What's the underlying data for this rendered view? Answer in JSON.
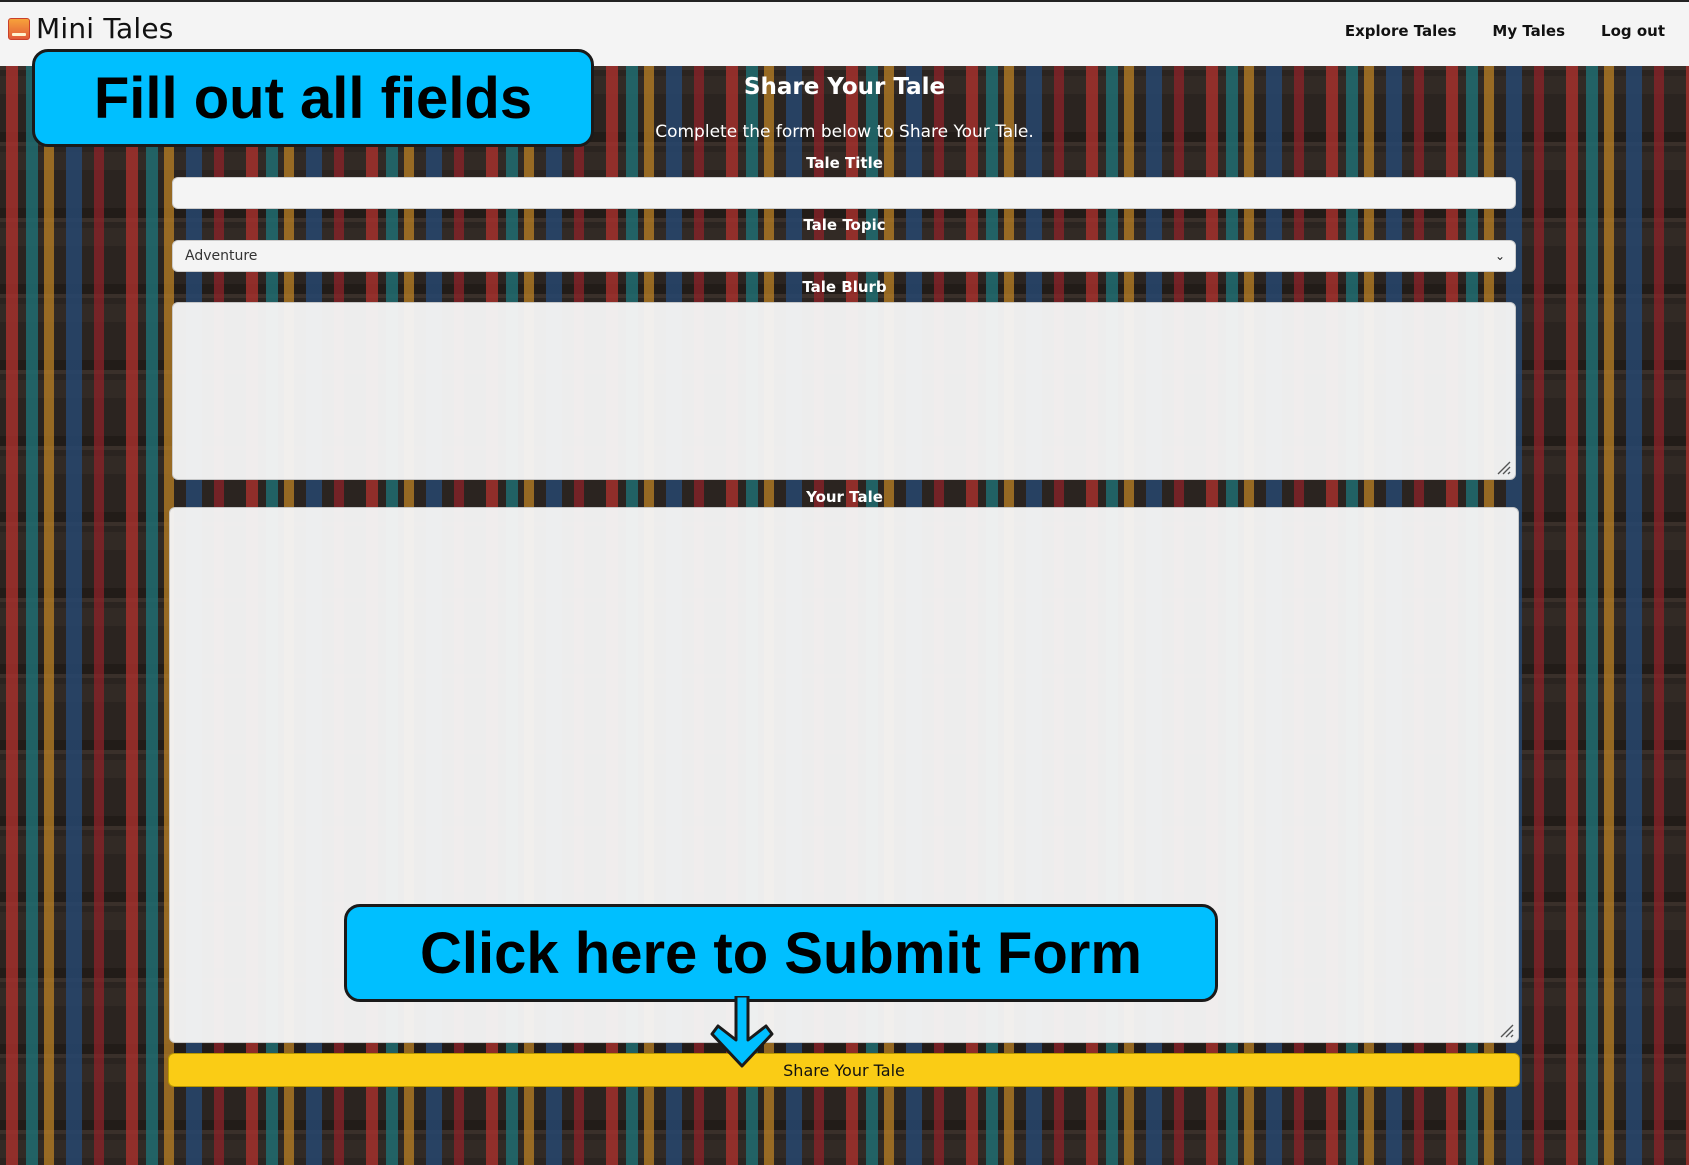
{
  "app": {
    "name": "Mini Tales"
  },
  "nav": {
    "items": [
      "Explore Tales",
      "My Tales",
      "Log out"
    ]
  },
  "form": {
    "title": "Share Your Tale",
    "subtitle": "Complete the form below to Share Your Tale.",
    "title_label": "Tale Title",
    "title_value": "",
    "topic_label": "Tale Topic",
    "topic_selected": "Adventure",
    "blurb_label": "Tale Blurb",
    "blurb_value": "",
    "tale_label": "Your Tale",
    "tale_value": "",
    "submit_label": "Share Your Tale"
  },
  "annotations": {
    "top": "Fill out all fields",
    "bottom": "Click here to Submit Form",
    "color": "#00bfff"
  },
  "icons": {
    "logo": "book-icon",
    "select": "chevron-down-icon",
    "resize": "resize-grip-icon",
    "arrow": "arrow-down-icon"
  }
}
